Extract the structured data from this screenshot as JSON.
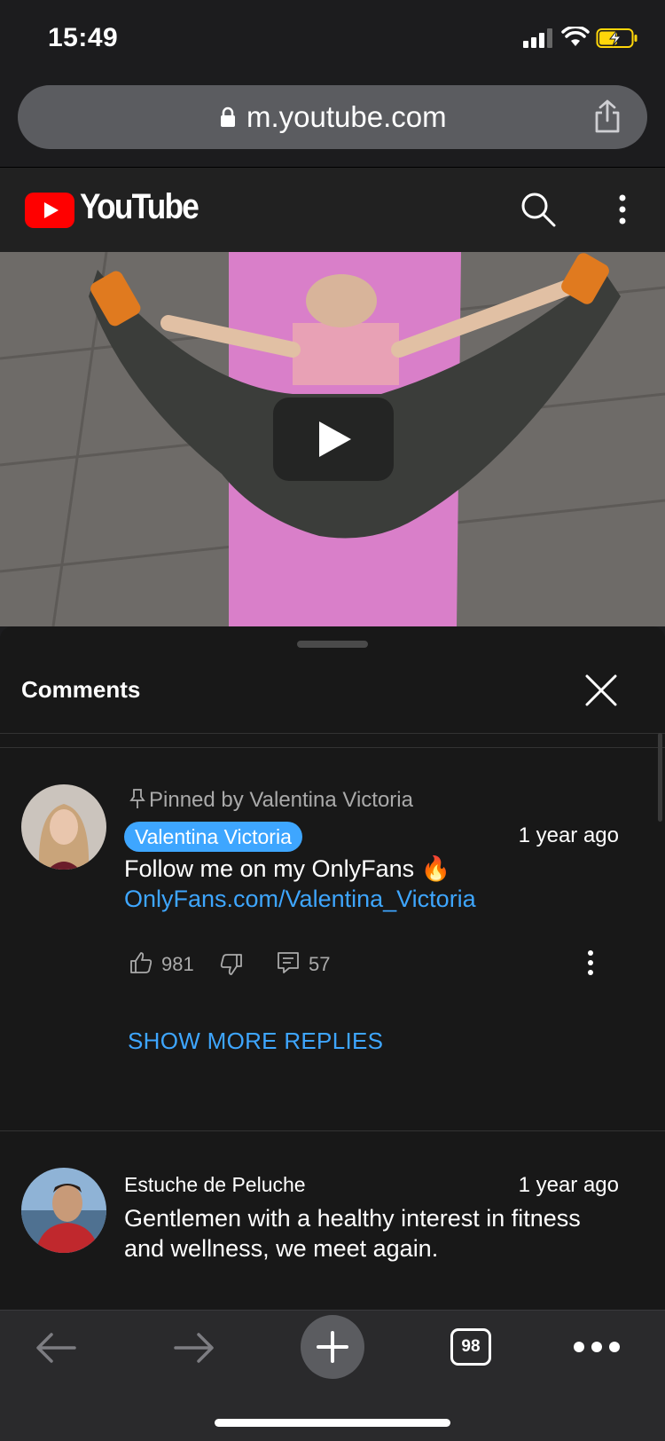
{
  "status_bar": {
    "time": "15:49"
  },
  "browser": {
    "url": "m.youtube.com"
  },
  "youtube_header": {
    "logo_text": "YouTube"
  },
  "comments": {
    "title": "Comments",
    "items": [
      {
        "pinned_label": "Pinned by Valentina Victoria",
        "author": "Valentina Victoria",
        "time": "1 year ago",
        "text": "Follow me on my OnlyFans 🔥",
        "link": "OnlyFans.com/Valentina_Victoria",
        "likes": "981",
        "replies": "57",
        "show_more": "SHOW MORE REPLIES"
      },
      {
        "author": "Estuche de Peluche",
        "time": "1 year ago",
        "text": "Gentlemen with a healthy interest in fitness and wellness, we meet again."
      }
    ]
  },
  "toolbar": {
    "tab_count": "98"
  },
  "colors": {
    "accent": "#3ea6ff",
    "youtube_red": "#ff0000",
    "sheet_bg": "#181818"
  }
}
